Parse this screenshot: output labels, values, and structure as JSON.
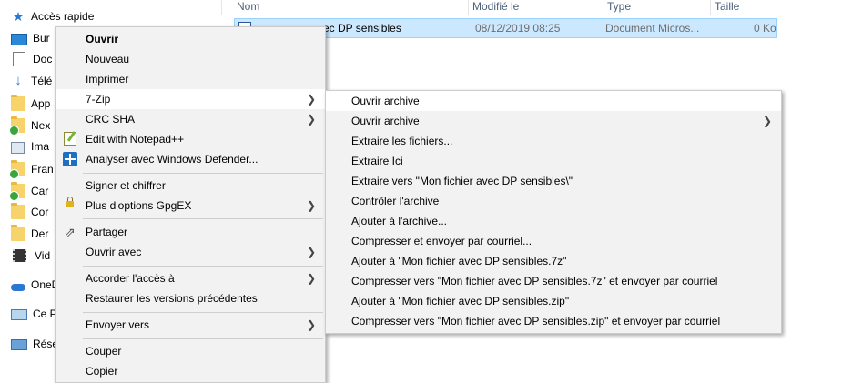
{
  "nav": {
    "quick_access": "Accès rapide",
    "items": [
      "Bur",
      "Doc",
      "Télé",
      "App",
      "Nex",
      "Ima",
      "Fran",
      "Car",
      "Cor",
      "Der",
      "Vid"
    ],
    "onedrive": "OneD",
    "this_pc": "Ce P",
    "network": "Résea"
  },
  "columns": {
    "name": "Nom",
    "modified": "Modifié le",
    "type": "Type",
    "size": "Taille"
  },
  "file": {
    "name": "ec DP sensibles",
    "modified": "08/12/2019 08:25",
    "type": "Document Micros...",
    "size": "0 Ko"
  },
  "context_menu": {
    "items": [
      "Ouvrir",
      "Nouveau",
      "Imprimer",
      "7-Zip",
      "CRC SHA",
      "Edit with Notepad++",
      "Analyser avec Windows Defender...",
      "Signer et chiffrer",
      "Plus d'options GpgEX",
      "Partager",
      "Ouvrir avec",
      "Accorder l'accès à",
      "Restaurer les versions précédentes",
      "Envoyer vers",
      "Couper",
      "Copier"
    ]
  },
  "submenu_7zip": {
    "items": [
      "Ouvrir archive",
      "Ouvrir archive",
      "Extraire les fichiers...",
      "Extraire Ici",
      "Extraire vers \"Mon fichier avec DP sensibles\\\"",
      "Contrôler l'archive",
      "Ajouter à l'archive...",
      "Compresser et envoyer par courriel...",
      "Ajouter à \"Mon fichier avec DP sensibles.7z\"",
      "Compresser vers \"Mon fichier avec DP sensibles.7z\" et envoyer par courriel",
      "Ajouter à \"Mon fichier avec DP sensibles.zip\"",
      "Compresser vers \"Mon fichier avec DP sensibles.zip\" et envoyer par courriel"
    ]
  },
  "colors": {
    "selection": "#cce8ff",
    "menu_bg": "#f2f2f2",
    "accent": "#0078d7"
  }
}
